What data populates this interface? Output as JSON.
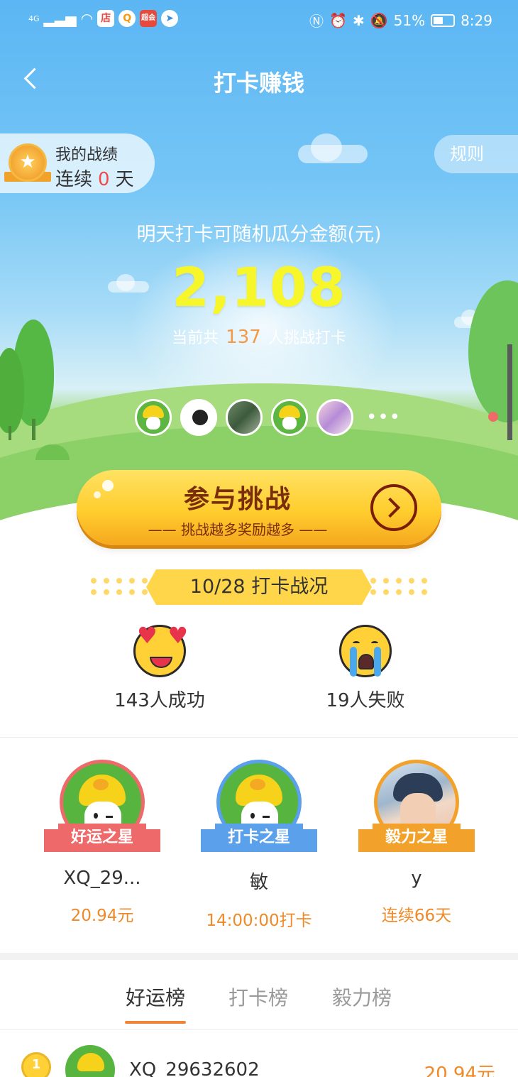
{
  "status_bar": {
    "network": "4G",
    "app_icon_1": "店",
    "app_icon_2": "Q",
    "app_icon_3": "超会",
    "battery": "51%",
    "time": "8:29",
    "battery_level": 0.51
  },
  "nav": {
    "title": "打卡赚钱"
  },
  "record": {
    "title": "我的战绩",
    "prefix": "连续",
    "days": "0",
    "suffix": "天"
  },
  "rules_label": "规则",
  "pool": {
    "hint": "明天打卡可随机瓜分金额(元)",
    "amount": "2,108",
    "prefix": "当前共",
    "count": "137",
    "suffix": "人挑战打卡"
  },
  "participants": [
    "mushroom-avatar",
    "chocolate-avatar",
    "crowd-photo-avatar",
    "mushroom-avatar",
    "girl-photo-avatar"
  ],
  "more_label": "•••",
  "join": {
    "label": "参与挑战",
    "sub": "—— 挑战越多奖励越多 ——"
  },
  "battle": {
    "title": "10/28 打卡战况",
    "success": "143人成功",
    "fail": "19人失败"
  },
  "stars": [
    {
      "badge": "好运之星",
      "name": "XQ_29...",
      "value": "20.94元",
      "color": "#ee6a6a"
    },
    {
      "badge": "打卡之星",
      "name": "敏",
      "value": "14:00:00打卡",
      "color": "#5aa0ea"
    },
    {
      "badge": "毅力之星",
      "name": "y",
      "value": "连续66天",
      "color": "#f2a22a"
    }
  ],
  "tabs": [
    {
      "label": "好运榜",
      "active": true
    },
    {
      "label": "打卡榜",
      "active": false
    },
    {
      "label": "毅力榜",
      "active": false
    }
  ],
  "ranking": [
    {
      "name": "XQ_29632602",
      "value": "20.94元"
    }
  ],
  "colors": {
    "amount": "#f6f62b",
    "accent_orange": "#ef8a2a",
    "button_yellow": "#ffcd2e",
    "tab_underline": "#f2843a"
  }
}
